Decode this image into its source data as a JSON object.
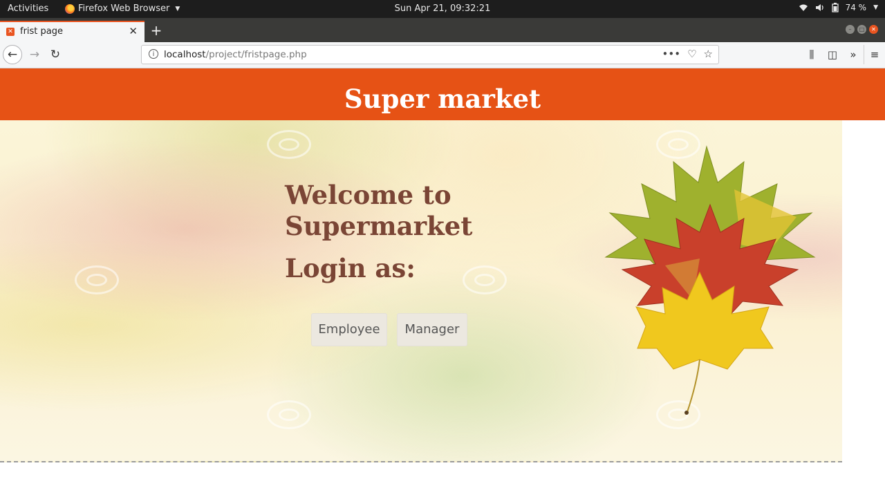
{
  "system_bar": {
    "activities": "Activities",
    "app_name": "Firefox Web Browser",
    "clock": "Sun Apr 21, 09:32:21",
    "battery": "74 %"
  },
  "browser": {
    "tab_title": "frist page",
    "url_host": "localhost",
    "url_path": "/project/fristpage.php",
    "icons": [
      "back-icon",
      "forward-icon",
      "reload-icon",
      "info-icon",
      "page-actions-icon",
      "pocket-icon",
      "bookmark-star-icon",
      "library-icon",
      "sidebar-icon",
      "overflow-icon",
      "menu-icon"
    ]
  },
  "page": {
    "header_title": "Super market",
    "welcome": "Welcome to Supermarket",
    "login_prompt": "Login as:",
    "buttons": {
      "employee": "Employee",
      "manager": "Manager"
    }
  },
  "colors": {
    "header_bg": "#e65215",
    "heading_text": "#7a4535",
    "accent": "#e95420"
  }
}
